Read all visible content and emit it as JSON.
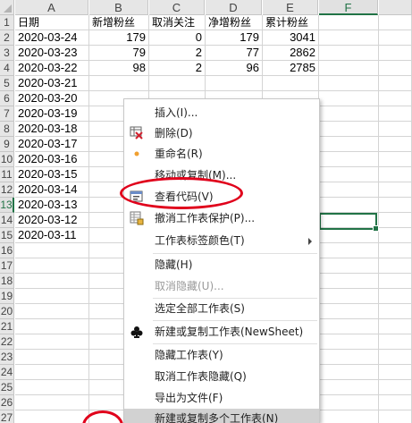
{
  "sheet": {
    "columns": [
      "A",
      "B",
      "C",
      "D",
      "E",
      "F"
    ],
    "header_row": [
      "日期",
      "新增粉丝",
      "取消关注",
      "净增粉丝",
      "累计粉丝"
    ],
    "rows": [
      [
        "2020-03-24",
        "179",
        "0",
        "179",
        "3041"
      ],
      [
        "2020-03-23",
        "79",
        "2",
        "77",
        "2862"
      ],
      [
        "2020-03-22",
        "98",
        "2",
        "96",
        "2785"
      ],
      [
        "2020-03-21",
        "",
        "",
        "",
        ""
      ],
      [
        "2020-03-20"
      ],
      [
        "2020-03-19"
      ],
      [
        "2020-03-18"
      ],
      [
        "2020-03-17"
      ],
      [
        "2020-03-16"
      ],
      [
        "2020-03-15"
      ],
      [
        "2020-03-14"
      ],
      [
        "2020-03-13"
      ],
      [
        "2020-03-12"
      ],
      [
        "2020-03-11"
      ]
    ],
    "row_numbers": [
      "1",
      "2",
      "3",
      "4",
      "5",
      "6",
      "7",
      "8",
      "9",
      "10",
      "11",
      "12",
      "13",
      "14",
      "15",
      "16",
      "17",
      "18",
      "19",
      "20",
      "21",
      "22",
      "23",
      "24",
      "25",
      "26",
      "27"
    ],
    "selected_column": "F",
    "selected_row": "13",
    "accent_color": "#217346"
  },
  "context_menu": {
    "items": [
      {
        "label": "插入(I)...",
        "icon": "",
        "disabled": false
      },
      {
        "label": "删除(D)",
        "icon": "delete-sheet-icon",
        "disabled": false
      },
      {
        "label": "重命名(R)",
        "icon": "rename-dot-icon",
        "disabled": false
      },
      {
        "label": "移动或复制(M)...",
        "icon": "",
        "disabled": false
      },
      {
        "label": "查看代码(V)",
        "icon": "view-code-icon",
        "disabled": false
      },
      {
        "label": "撤消工作表保护(P)...",
        "icon": "unprotect-sheet-icon",
        "disabled": false
      },
      {
        "label": "工作表标签颜色(T)",
        "icon": "",
        "disabled": false,
        "submenu": true
      },
      {
        "label": "隐藏(H)",
        "icon": "",
        "disabled": false
      },
      {
        "label": "取消隐藏(U)...",
        "icon": "",
        "disabled": true
      },
      {
        "label": "选定全部工作表(S)",
        "icon": "",
        "disabled": false
      },
      {
        "label": "新建或复制工作表(NewSheet)",
        "icon": "club-icon",
        "disabled": false
      },
      {
        "label": "隐藏工作表(Y)",
        "icon": "",
        "disabled": false
      },
      {
        "label": "取消工作表隐藏(Q)",
        "icon": "",
        "disabled": false
      },
      {
        "label": "导出为文件(F)",
        "icon": "",
        "disabled": false
      },
      {
        "label": "新建或复制多个工作表(N)",
        "icon": "",
        "disabled": false,
        "highlighted": true
      }
    ],
    "annotation_color": "#e0001b"
  }
}
